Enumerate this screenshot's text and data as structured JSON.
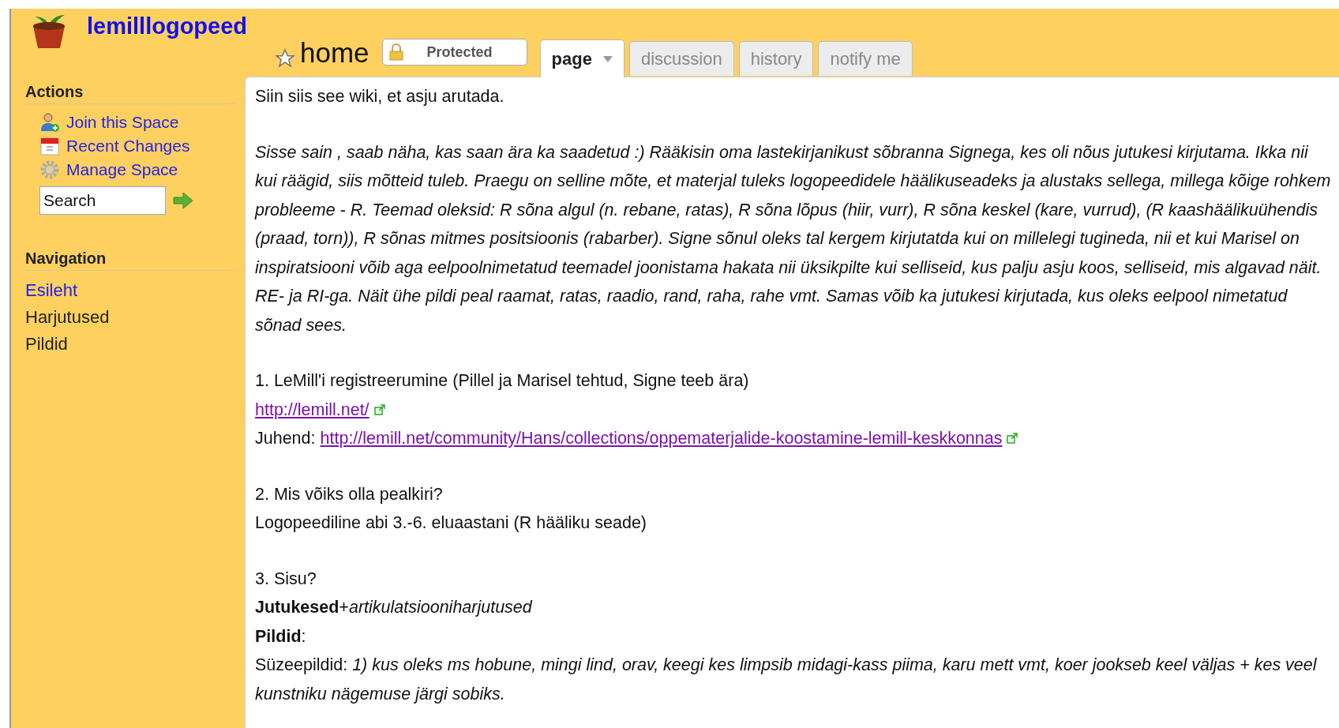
{
  "site": {
    "title": "lemilllogopeed"
  },
  "page": {
    "title": "home",
    "starred": false,
    "protection": "Protected"
  },
  "tabs": [
    {
      "label": "page",
      "selected": true,
      "dropdown": true
    },
    {
      "label": "discussion",
      "selected": false,
      "dropdown": false
    },
    {
      "label": "history",
      "selected": false,
      "dropdown": false
    },
    {
      "label": "notify me",
      "selected": false,
      "dropdown": false
    }
  ],
  "sidebar": {
    "actions_heading": "Actions",
    "actions": [
      {
        "kind": "join",
        "label": "Join this Space"
      },
      {
        "kind": "calendar",
        "label": "Recent Changes"
      },
      {
        "kind": "gear",
        "label": "Manage Space"
      }
    ],
    "search": {
      "value": "Search"
    },
    "navigation_heading": "Navigation",
    "navigation": [
      {
        "label": "Esileht",
        "selected": true
      },
      {
        "label": "Harjutused",
        "selected": false
      },
      {
        "label": "Pildid",
        "selected": false
      }
    ]
  },
  "content": [
    {
      "lines": [
        {
          "kind": "text",
          "text": "Siin siis see wiki, et asju arutada."
        }
      ]
    },
    {
      "lines": [
        {
          "kind": "italic",
          "text": "Sisse sain , saab näha, kas saan ära ka saadetud :) Rääkisin oma lastekirjanikust sõbranna Signega, kes oli nõus jutukesi kirjutama. Ikka nii kui räägid, siis mõtteid tuleb. Praegu on selline mõte, et materjal tuleks logopeedidele häälikuseadeks ja alustaks sellega, millega kõige rohkem probleeme - R. Teemad oleksid: R sõna algul (n. rebane, ratas), R sõna lõpus (hiir, vurr), R sõna keskel (kare, vurrud), (R kaashäälikuühendis (praad, torn)), R sõnas mitmes positsioonis (rabarber). Signe sõnul oleks tal kergem kirjutatda kui on millelegi tugineda, nii et kui Marisel on inspiratsiooni võib aga eelpoolnimetatud teemadel joonistama hakata nii üksikpilte kui selliseid, kus palju asju koos, selliseid, mis algavad näit. RE- ja RI-ga. Näit ühe pildi peal raamat, ratas, raadio, rand, raha, rahe vmt. Samas võib ka jutukesi kirjutada, kus oleks eelpool nimetatud sõnad sees."
        }
      ]
    },
    {
      "lines": [
        {
          "kind": "text",
          "text": "1. LeMill'i registreerumine (Pillel ja Marisel tehtud, Signe teeb ära)"
        },
        {
          "kind": "link",
          "url": "http://lemill.net/"
        },
        {
          "kind": "link",
          "label": "Juhend:",
          "url": "http://lemill.net/community/Hans/collections/oppematerjalide-koostamine-lemill-keskkonnas"
        }
      ]
    },
    {
      "lines": [
        {
          "kind": "text",
          "text": "2. Mis võiks olla pealkiri?"
        },
        {
          "kind": "text",
          "text": "Logopeediline abi 3.-6. eluaastani (R hääliku seade)"
        }
      ]
    },
    {
      "lines": [
        {
          "kind": "text",
          "text": "3. Sisu?"
        },
        {
          "kind": "text",
          "text": "**Jutukesed**+*artikulatsiooniharjutused*"
        },
        {
          "kind": "text",
          "text": "**Pildid**:"
        },
        {
          "kind": "text",
          "text": "Süzeepildid: *1) kus oleks ms hobune, mingi lind, orav, keegi kes limpsib midagi-kass piima, karu mett vmt, koer jookseb keel väljas + kes veel kunstniku nägemuse järgi sobiks.*"
        }
      ]
    }
  ]
}
